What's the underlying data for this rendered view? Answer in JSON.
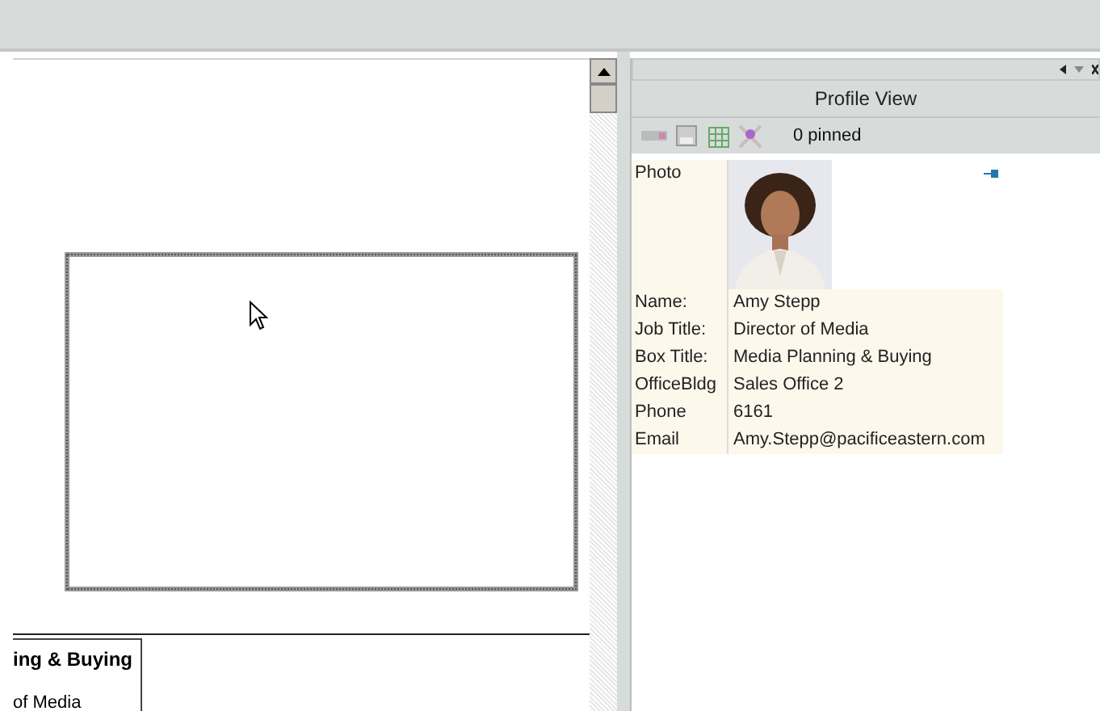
{
  "profile_panel": {
    "title": "Profile View",
    "pinned_count": "0 pinned",
    "photo": {
      "label": "Photo",
      "kind": "picture"
    },
    "fields": [
      {
        "label": "Name:",
        "value": "Amy Stepp"
      },
      {
        "label": "Job Title:",
        "value": "Director of Media"
      },
      {
        "label": "Box Title:",
        "value": "Media Planning & Buying"
      },
      {
        "label": "OfficeBldg",
        "value": "Sales Office 2"
      },
      {
        "label": "Phone",
        "value": "6161"
      },
      {
        "label": "Email",
        "value": "Amy.Stepp@pacificeastern.com"
      }
    ]
  },
  "canvas": {
    "org_box": {
      "title": "ing & Buying",
      "subtitle": "of Media"
    }
  }
}
